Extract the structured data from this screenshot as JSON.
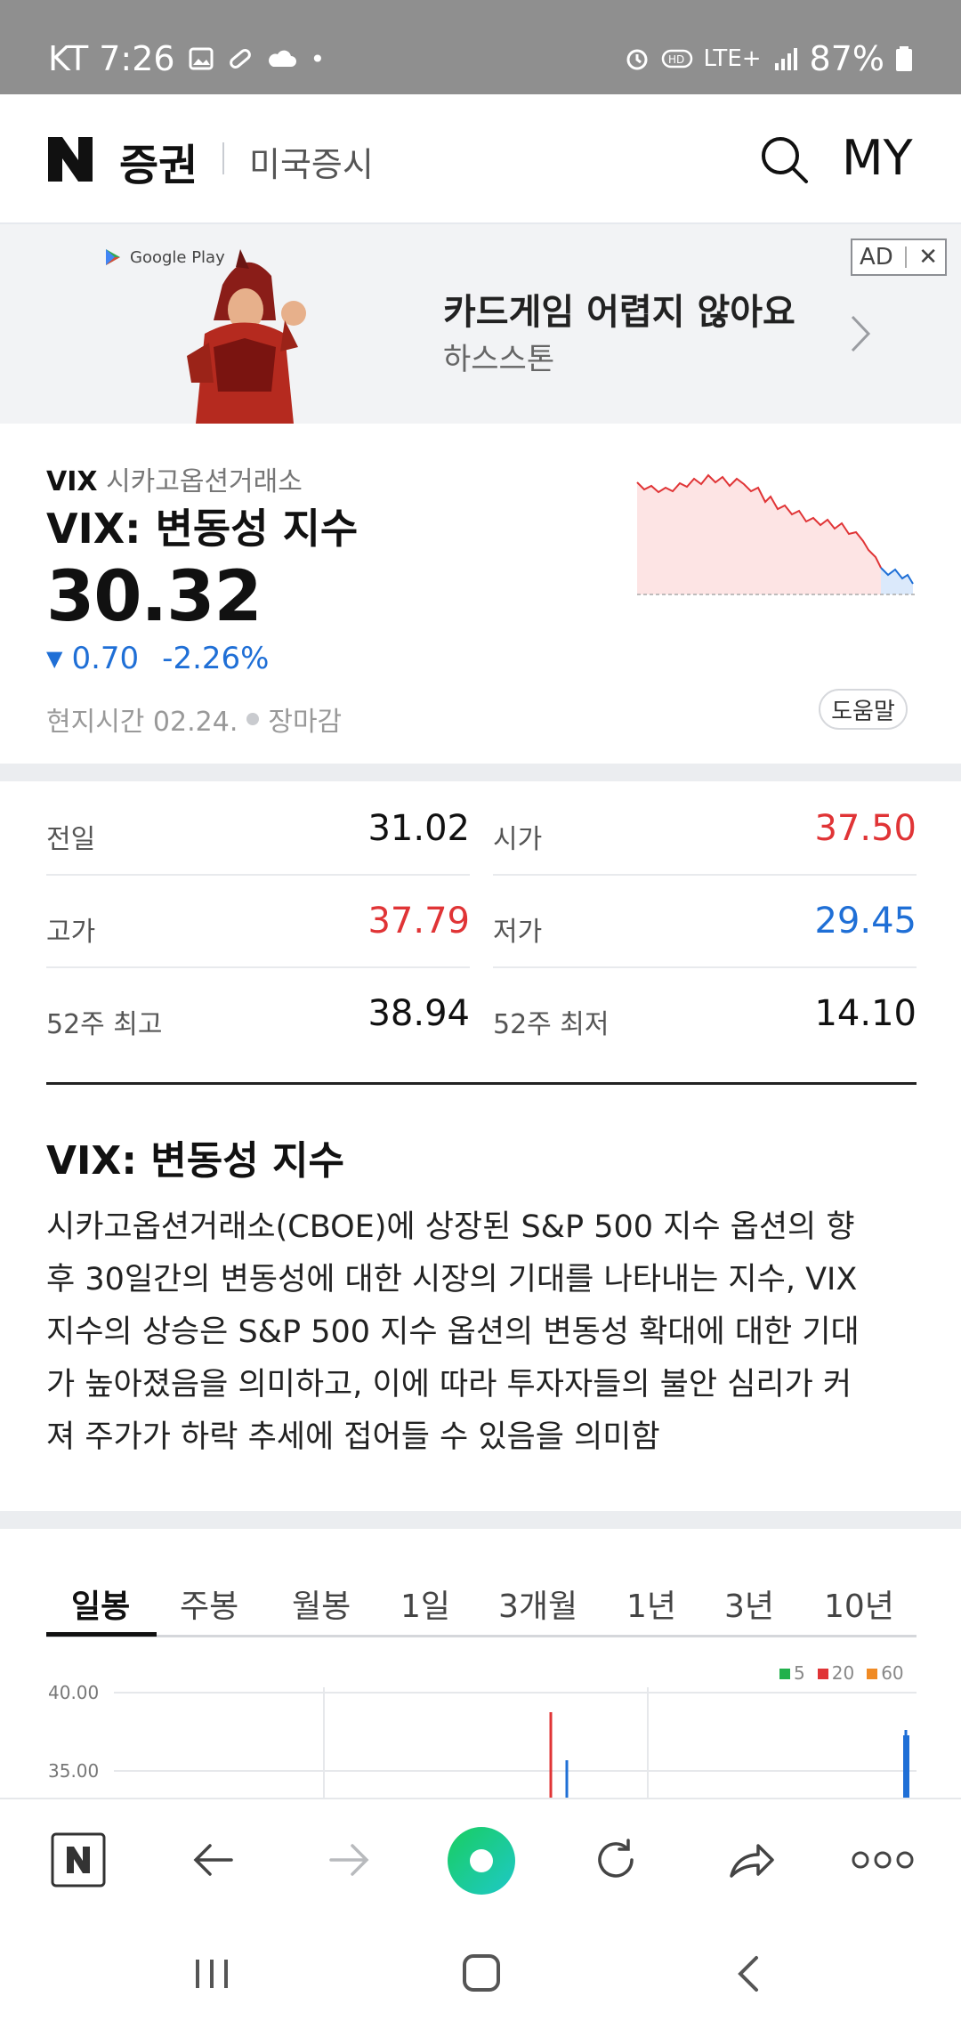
{
  "status_bar": {
    "carrier_time": "KT 7:26",
    "dot": "•",
    "network": "LTE+",
    "battery": "87%"
  },
  "header": {
    "logo": "N",
    "brand": "증권",
    "section": "미국증시",
    "my_label": "MY"
  },
  "ad": {
    "store": "Google Play",
    "title": "카드게임 어렵지 않아요",
    "subtitle": "하스스톤",
    "ad_label": "AD",
    "close": "✕"
  },
  "stock": {
    "ticker": "VIX",
    "exchange": "시카고옵션거래소",
    "name": "VIX: 변동성 지수",
    "price": "30.32",
    "change_arrow": "▼",
    "change": "0.70",
    "change_pct": "-2.26%",
    "time_label": "현지시간 02.24.",
    "market_status": "장마감",
    "help": "도움말"
  },
  "stats": {
    "prev_close_label": "전일",
    "prev_close": "31.02",
    "open_label": "시가",
    "open": "37.50",
    "high_label": "고가",
    "high": "37.79",
    "low_label": "저가",
    "low": "29.45",
    "w52_high_label": "52주 최고",
    "w52_high": "38.94",
    "w52_low_label": "52주 최저",
    "w52_low": "14.10"
  },
  "description": {
    "title": "VIX: 변동성 지수",
    "lines": [
      "시카고옵션거래소(CBOE)에 상장된 S&P 500 지수 옵션의 향",
      "후 30일간의 변동성에 대한 시장의 기대를 나타내는 지수, VIX",
      "지수의 상승은 S&P 500 지수 옵션의 변동성 확대에 대한 기대",
      "가 높아졌음을 의미하고, 이에 따라 투자자들의 불안 심리가 커",
      "져 주가가 하락 추세에 접어들 수 있음을 의미함"
    ]
  },
  "tabs": [
    "일봉",
    "주봉",
    "월봉",
    "1일",
    "3개월",
    "1년",
    "3년",
    "10년"
  ],
  "chart": {
    "legend": [
      "5",
      "20",
      "60"
    ],
    "legend_colors": [
      "#22b14c",
      "#e03436",
      "#f08a24"
    ],
    "y_labels": [
      "40.00",
      "35.00"
    ]
  },
  "colors": {
    "up": "#e03436",
    "down": "#1f6fd6",
    "accent": "#19ce60"
  }
}
